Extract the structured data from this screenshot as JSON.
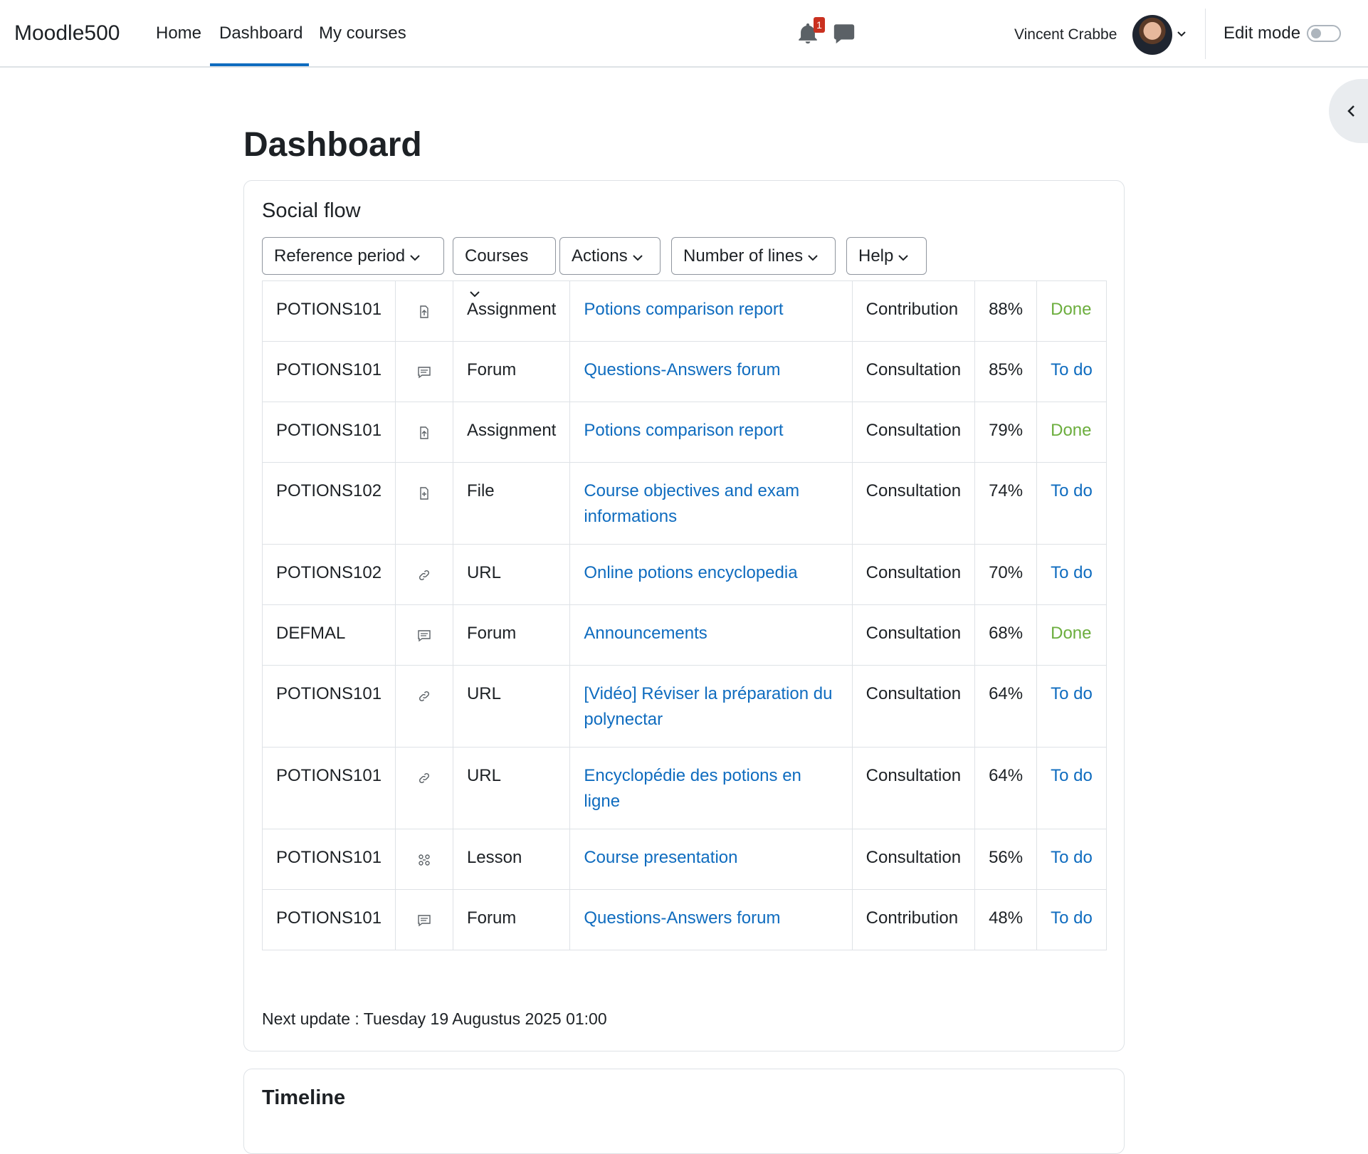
{
  "navbar": {
    "brand": "Moodle500",
    "links": [
      "Home",
      "Dashboard",
      "My courses"
    ],
    "active": "Dashboard",
    "notification_count": "1",
    "user_name": "Vincent Crabbe",
    "edit_mode_label": "Edit mode",
    "edit_mode_on": false
  },
  "page": {
    "title": "Dashboard"
  },
  "social_flow": {
    "title": "Social flow",
    "filters": [
      "Reference period",
      "Courses",
      "Actions",
      "Number of lines",
      "Help"
    ],
    "rows": [
      {
        "course": "POTIONS101",
        "icon": "assignment-icon",
        "type": "Assignment",
        "name": "Potions comparison report",
        "action": "Contribution",
        "percent": "88%",
        "status": "Done"
      },
      {
        "course": "POTIONS101",
        "icon": "forum-icon",
        "type": "Forum",
        "name": "Questions-Answers forum",
        "action": "Consultation",
        "percent": "85%",
        "status": "To do"
      },
      {
        "course": "POTIONS101",
        "icon": "assignment-icon",
        "type": "Assignment",
        "name": "Potions comparison report",
        "action": "Consultation",
        "percent": "79%",
        "status": "Done"
      },
      {
        "course": "POTIONS102",
        "icon": "file-icon",
        "type": "File",
        "name": "Course objectives and exam informations",
        "action": "Consultation",
        "percent": "74%",
        "status": "To do"
      },
      {
        "course": "POTIONS102",
        "icon": "url-icon",
        "type": "URL",
        "name": "Online potions encyclopedia",
        "action": "Consultation",
        "percent": "70%",
        "status": "To do"
      },
      {
        "course": "DEFMAL",
        "icon": "forum-icon",
        "type": "Forum",
        "name": "Announcements",
        "action": "Consultation",
        "percent": "68%",
        "status": "Done"
      },
      {
        "course": "POTIONS101",
        "icon": "url-icon",
        "type": "URL",
        "name": "[Vidéo] Réviser la préparation du polynectar",
        "action": "Consultation",
        "percent": "64%",
        "status": "To do"
      },
      {
        "course": "POTIONS101",
        "icon": "url-icon",
        "type": "URL",
        "name": "Encyclopédie des potions en ligne",
        "action": "Consultation",
        "percent": "64%",
        "status": "To do"
      },
      {
        "course": "POTIONS101",
        "icon": "lesson-icon",
        "type": "Lesson",
        "name": "Course presentation",
        "action": "Consultation",
        "percent": "56%",
        "status": "To do"
      },
      {
        "course": "POTIONS101",
        "icon": "forum-icon",
        "type": "Forum",
        "name": "Questions-Answers forum",
        "action": "Contribution",
        "percent": "48%",
        "status": "To do"
      }
    ],
    "next_update": "Next update : Tuesday 19 Augustus 2025 01:00"
  },
  "timeline": {
    "title": "Timeline"
  },
  "colors": {
    "accent": "#0f6cbf",
    "done": "#6cae3e",
    "border": "#dee2e6",
    "badge": "#ca3120"
  }
}
